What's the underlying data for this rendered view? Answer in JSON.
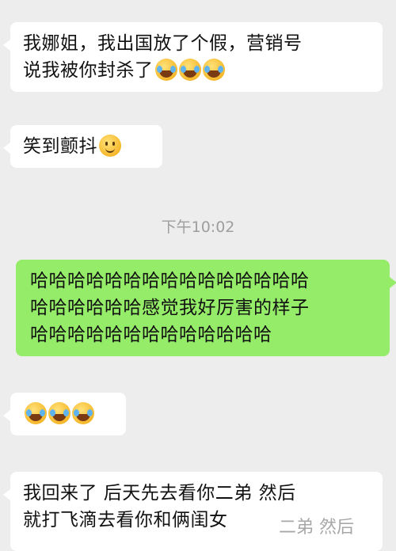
{
  "messages": [
    {
      "side": "incoming",
      "lines": [
        "我娜姐，我出国放了个假，营销号",
        "说我被你封杀了"
      ],
      "trailing_emojis": [
        "laugh-cry-emoji",
        "laugh-cry-emoji",
        "laugh-cry-emoji"
      ]
    },
    {
      "side": "incoming",
      "lines": [
        "笑到颤抖"
      ],
      "trailing_emojis": [
        "smile-emoji"
      ]
    },
    {
      "side": "outgoing",
      "lines": [
        "哈哈哈哈哈哈哈哈哈哈哈哈哈哈哈",
        "哈哈哈哈哈哈感觉我好厉害的样子",
        "哈哈哈哈哈哈哈哈哈哈哈哈哈"
      ]
    },
    {
      "side": "incoming",
      "lines": [
        ""
      ],
      "trailing_emojis": [
        "laugh-cry-emoji",
        "laugh-cry-emoji",
        "laugh-cry-emoji"
      ]
    },
    {
      "side": "incoming",
      "lines": [
        "我回来了 后天先去看你二弟 然后",
        "就打飞滴去看你和俩闺女"
      ]
    }
  ],
  "timestamp": "下午10:02",
  "watermark": "二弟 然后",
  "colors": {
    "background": "#ededed",
    "incoming_bubble": "#ffffff",
    "outgoing_bubble": "#95ec69",
    "timestamp_text": "#9e9e9e"
  }
}
